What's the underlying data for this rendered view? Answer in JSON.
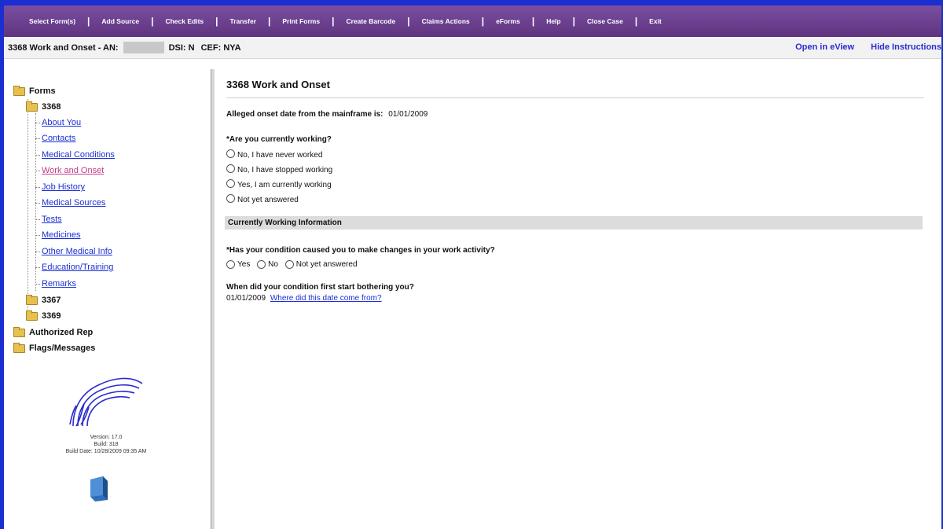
{
  "menu": {
    "items": [
      "Select Form(s)",
      "Add Source",
      "Check Edits",
      "Transfer",
      "Print Forms",
      "Create Barcode",
      "Claims Actions",
      "eForms",
      "Help",
      "Close Case",
      "Exit"
    ]
  },
  "subheader": {
    "title": "3368 Work and Onset - AN:",
    "dsi": "DSI: N",
    "cef": "CEF: NYA",
    "open_eview": "Open in eView",
    "hide_instructions": "Hide Instructions"
  },
  "tree": {
    "root": "Forms",
    "form_3368": "3368",
    "items": [
      "About You",
      "Contacts",
      "Medical Conditions",
      "Work and Onset",
      "Job History",
      "Medical Sources",
      "Tests",
      "Medicines",
      "Other Medical Info",
      "Education/Training",
      "Remarks"
    ],
    "form_3367": "3367",
    "form_3369": "3369",
    "authorized_rep": "Authorized Rep",
    "flags_messages": "Flags/Messages"
  },
  "version": {
    "version": "Version: 17.0",
    "build": "Build: 318",
    "build_date": "Build Date: 10/28/2009 09:35 AM"
  },
  "content": {
    "title": "3368 Work and Onset",
    "onset_label": "Alleged onset date from the mainframe is:",
    "onset_value": "01/01/2009",
    "q1": "*Are you currently working?",
    "q1_options": [
      "No, I have never worked",
      "No, I have stopped working",
      "Yes, I am currently working",
      "Not yet answered"
    ],
    "section": "Currently Working Information",
    "q2": "*Has your condition caused you to make changes in your work activity?",
    "q2_options": [
      "Yes",
      "No",
      "Not yet answered"
    ],
    "q3": "When did your condition first start bothering you?",
    "q3_value": "01/01/2009",
    "q3_link": "Where did this date come from?"
  },
  "colors": {
    "menubar": "#6a3d8e",
    "frame": "#1b2fd1",
    "link": "#1a2fd6",
    "active_link": "#c03a8a"
  }
}
